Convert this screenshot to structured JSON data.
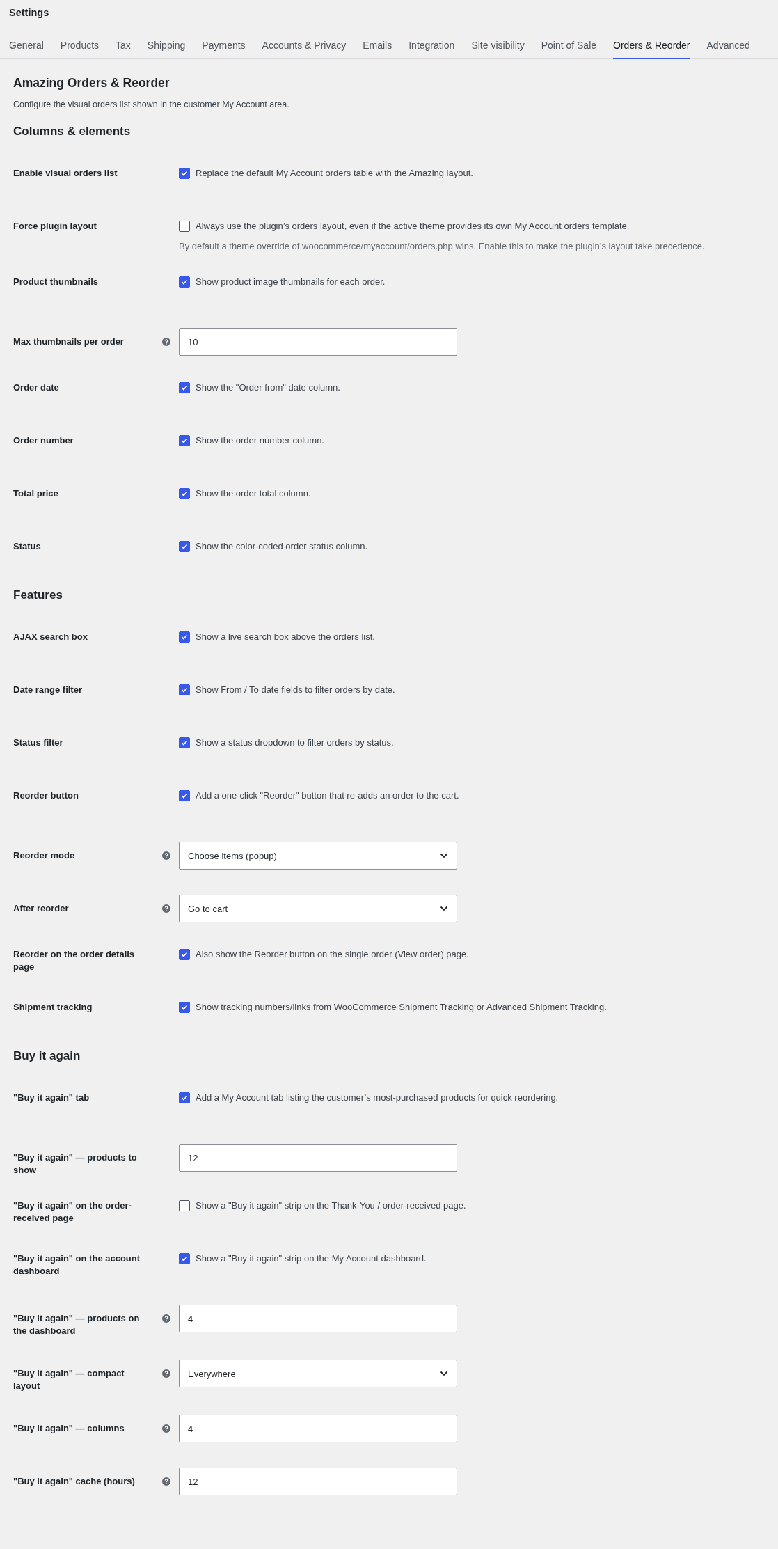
{
  "window": {
    "title": "Settings"
  },
  "tabs": [
    {
      "label": "General",
      "selected": false
    },
    {
      "label": "Products",
      "selected": false
    },
    {
      "label": "Tax",
      "selected": false
    },
    {
      "label": "Shipping",
      "selected": false
    },
    {
      "label": "Payments",
      "selected": false
    },
    {
      "label": "Accounts & Privacy",
      "selected": false
    },
    {
      "label": "Emails",
      "selected": false
    },
    {
      "label": "Integration",
      "selected": false
    },
    {
      "label": "Site visibility",
      "selected": false
    },
    {
      "label": "Point of Sale",
      "selected": false
    },
    {
      "label": "Orders & Reorder",
      "selected": true
    },
    {
      "label": "Advanced",
      "selected": false
    }
  ],
  "page": {
    "title": "Amazing Orders & Reorder",
    "description": "Configure the visual orders list shown in the customer My Account area."
  },
  "sections": [
    {
      "heading": "Columns & elements",
      "fields": [
        {
          "kind": "checkbox",
          "label": "Enable visual orders list",
          "help": false,
          "checked": true,
          "text": "Replace the default My Account orders table with the Amazing layout."
        },
        {
          "kind": "checkbox",
          "label": "Force plugin layout",
          "help": false,
          "checked": false,
          "text": "Always use the plugin’s orders layout, even if the active theme provides its own My Account orders template.",
          "note": "By default a theme override of woocommerce/myaccount/orders.php wins. Enable this to make the plugin’s layout take precedence."
        },
        {
          "kind": "checkbox",
          "label": "Product thumbnails",
          "help": false,
          "checked": true,
          "text": "Show product image thumbnails for each order."
        },
        {
          "kind": "number",
          "label": "Max thumbnails per order",
          "help": true,
          "value": "10"
        },
        {
          "kind": "checkbox",
          "label": "Order date",
          "help": false,
          "checked": true,
          "text": "Show the \"Order from\" date column."
        },
        {
          "kind": "checkbox",
          "label": "Order number",
          "help": false,
          "checked": true,
          "text": "Show the order number column."
        },
        {
          "kind": "checkbox",
          "label": "Total price",
          "help": false,
          "checked": true,
          "text": "Show the order total column."
        },
        {
          "kind": "checkbox",
          "label": "Status",
          "help": false,
          "checked": true,
          "text": "Show the color-coded order status column."
        }
      ]
    },
    {
      "heading": "Features",
      "fields": [
        {
          "kind": "checkbox",
          "label": "AJAX search box",
          "help": false,
          "checked": true,
          "text": "Show a live search box above the orders list."
        },
        {
          "kind": "checkbox",
          "label": "Date range filter",
          "help": false,
          "checked": true,
          "text": "Show From / To date fields to filter orders by date."
        },
        {
          "kind": "checkbox",
          "label": "Status filter",
          "help": false,
          "checked": true,
          "text": "Show a status dropdown to filter orders by status."
        },
        {
          "kind": "checkbox",
          "label": "Reorder button",
          "help": false,
          "checked": true,
          "text": "Add a one-click \"Reorder\" button that re-adds an order to the cart."
        },
        {
          "kind": "select",
          "label": "Reorder mode",
          "help": true,
          "value": "Choose items (popup)"
        },
        {
          "kind": "select",
          "label": "After reorder",
          "help": true,
          "value": "Go to cart"
        },
        {
          "kind": "checkbox",
          "label": "Reorder on the order details page",
          "help": false,
          "checked": true,
          "text": "Also show the Reorder button on the single order (View order) page."
        },
        {
          "kind": "checkbox",
          "label": "Shipment tracking",
          "help": false,
          "checked": true,
          "text": "Show tracking numbers/links from WooCommerce Shipment Tracking or Advanced Shipment Tracking."
        }
      ]
    },
    {
      "heading": "Buy it again",
      "fields": [
        {
          "kind": "checkbox",
          "label": "\"Buy it again\" tab",
          "help": false,
          "checked": true,
          "text": "Add a My Account tab listing the customer’s most-purchased products for quick reordering."
        },
        {
          "kind": "number",
          "label": "\"Buy it again\" — products to show",
          "help": false,
          "value": "12"
        },
        {
          "kind": "checkbox",
          "label": "\"Buy it again\" on the order-received page",
          "help": false,
          "checked": false,
          "text": "Show a \"Buy it again\" strip on the Thank-You / order-received page."
        },
        {
          "kind": "checkbox",
          "label": "\"Buy it again\" on the account dashboard",
          "help": false,
          "checked": true,
          "text": "Show a \"Buy it again\" strip on the My Account dashboard."
        },
        {
          "kind": "number",
          "label": "\"Buy it again\" — products on the dashboard",
          "help": true,
          "value": "4"
        },
        {
          "kind": "select",
          "label": "\"Buy it again\" — compact layout",
          "help": true,
          "value": "Everywhere"
        },
        {
          "kind": "number",
          "label": "\"Buy it again\" — columns",
          "help": true,
          "value": "4"
        },
        {
          "kind": "number",
          "label": "\"Buy it again\" cache (hours)",
          "help": true,
          "value": "12"
        }
      ]
    }
  ]
}
